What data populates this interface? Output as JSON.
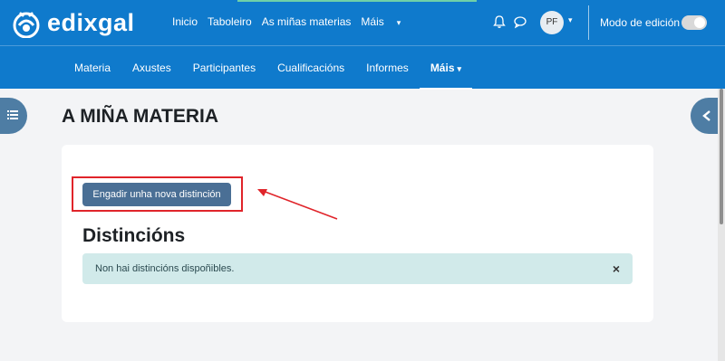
{
  "brand": {
    "name": "edixgal"
  },
  "topnav": {
    "items": [
      "Inicio",
      "Taboleiro",
      "As miñas materias"
    ],
    "more_label": "Máis"
  },
  "user": {
    "initials": "PF"
  },
  "edit_mode": {
    "label": "Modo de edición",
    "enabled": true
  },
  "secondary_nav": {
    "items": [
      "Materia",
      "Axustes",
      "Participantes",
      "Cualificacións",
      "Informes"
    ],
    "more_label": "Máis"
  },
  "page": {
    "title": "A MIÑA MATERIA"
  },
  "card": {
    "add_button_label": "Engadir unha nova distinción",
    "section_title": "Distincións",
    "alert_text": "Non hai distincións dispoñibles.",
    "alert_close_glyph": "×"
  },
  "colors": {
    "brand_blue": "#0f7acc",
    "button_blue": "#4a6f95",
    "alert_bg": "#d1eaea",
    "annotation_red": "#e0242a"
  }
}
